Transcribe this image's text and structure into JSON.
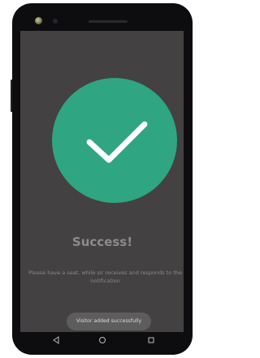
{
  "success": {
    "title": "Success!",
    "message": "Please have a seat, while sir receives and responds to the notification",
    "icon": "checkmark-icon",
    "accent_color": "#2fa582"
  },
  "toast": {
    "text": "Visitor added successfully"
  },
  "navigation": {
    "back_icon": "back-triangle-icon",
    "home_icon": "home-circle-icon",
    "recents_icon": "recents-square-icon"
  },
  "colors": {
    "screen_background": "#434141",
    "frame": "#0d0d0f",
    "toast_background": "#5e5d5d"
  }
}
